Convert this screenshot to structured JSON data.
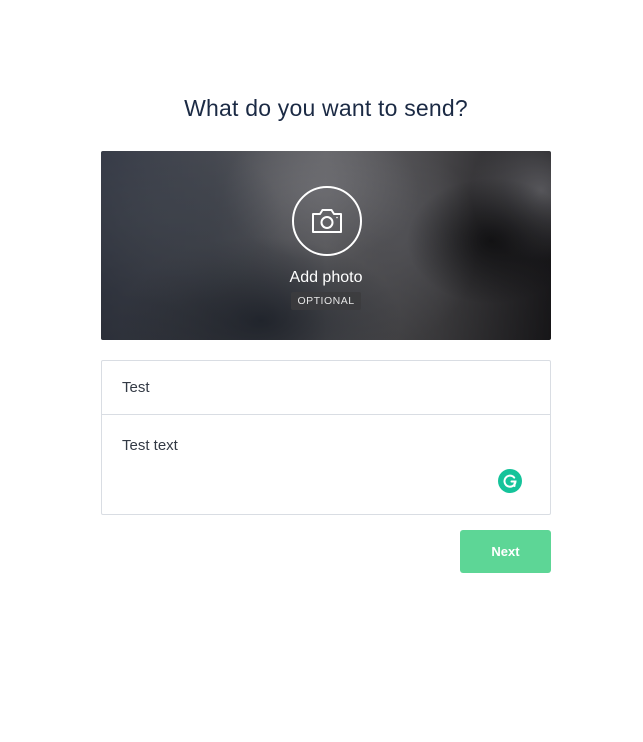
{
  "header": {
    "title": "What do you want to send?"
  },
  "photo": {
    "add_label": "Add photo",
    "optional_label": "OPTIONAL",
    "icon": "camera-icon"
  },
  "form": {
    "subject_value": "Test",
    "message_value": "Test text",
    "grammarly_icon": "grammarly-icon",
    "grammarly_color": "#15c39a"
  },
  "actions": {
    "next_label": "Next",
    "next_color": "#5dd696"
  },
  "colors": {
    "title": "#1b2a44",
    "border": "#d9dde3",
    "text": "#333a45"
  }
}
